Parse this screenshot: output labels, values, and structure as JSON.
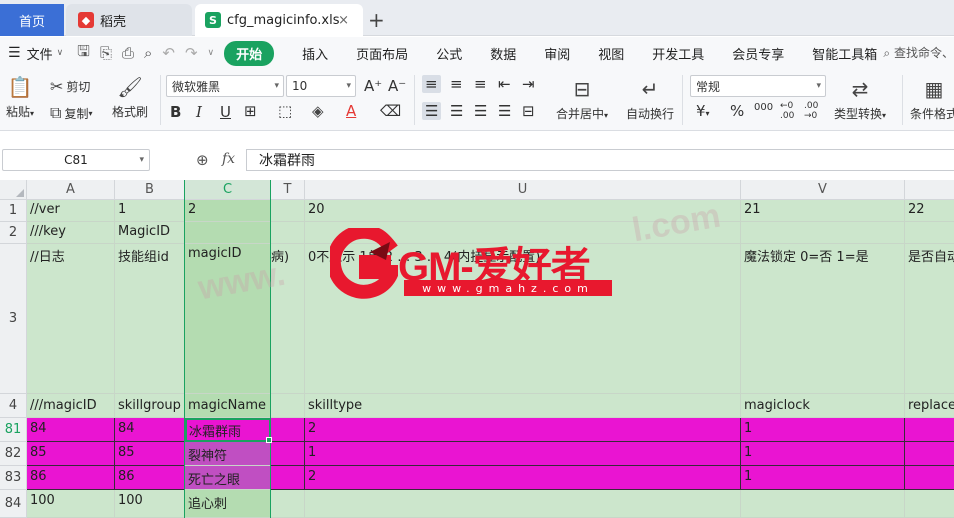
{
  "tabs": {
    "home": "首页",
    "daoke": "稻壳",
    "file": "cfg_magicinfo.xls",
    "close": "×",
    "add": "+"
  },
  "menu": {
    "file": "文件",
    "items": [
      "开始",
      "插入",
      "页面布局",
      "公式",
      "数据",
      "审阅",
      "视图",
      "开发工具",
      "会员专享",
      "智能工具箱"
    ],
    "search": "查找命令、"
  },
  "ribbon": {
    "paste": "粘贴",
    "cut": "剪切",
    "copy": "复制",
    "format_painter": "格式刷",
    "font": "微软雅黑",
    "font_size": "10",
    "merge_center": "合并居中",
    "wrap": "自动换行",
    "number_format": "常规",
    "type_convert": "类型转换",
    "conditional_format": "条件格式",
    "percent": "%",
    "currency": "¥"
  },
  "formula_bar": {
    "name_box": "C81",
    "fx": "fx",
    "value": "冰霜群雨"
  },
  "sheet": {
    "columns": [
      "A",
      "B",
      "C",
      "T",
      "U",
      "V"
    ],
    "row_numbers": [
      "1",
      "2",
      "3",
      "4",
      "81",
      "82",
      "83",
      "84"
    ],
    "rows": [
      [
        "//ver",
        "1",
        "2",
        "",
        "20",
        "21",
        "22"
      ],
      [
        "///key",
        "MagicID",
        "",
        "",
        "",
        "",
        ""
      ],
      [
        "//日志",
        "技能组id",
        "magicID",
        "病)",
        "0不显示 1单 2 … 3 … 4(内挂显示配置)",
        "魔法锁定 0=否 1=是",
        "是否自动"
      ],
      [
        "///magicID",
        "skillgroup",
        "magicName",
        "",
        "skilltype",
        "magiclock",
        "replace"
      ],
      [
        "84",
        "84",
        "冰霜群雨",
        "",
        "2",
        "1",
        ""
      ],
      [
        "85",
        "85",
        "裂神符",
        "",
        "1",
        "1",
        ""
      ],
      [
        "86",
        "86",
        "死亡之眼",
        "",
        "2",
        "1",
        ""
      ],
      [
        "100",
        "100",
        "追心刺",
        "",
        "",
        "",
        ""
      ]
    ]
  },
  "watermark": {
    "logo": "GM-爱好者",
    "url": "www.gmahz.com",
    "ghost_left": "www.",
    "ghost_right": "l.com"
  },
  "colors": {
    "accent": "#1aa260",
    "row_green": "#cce6cc",
    "row_magenta": "#ea14d2",
    "watermark_red": "#e8182e"
  }
}
